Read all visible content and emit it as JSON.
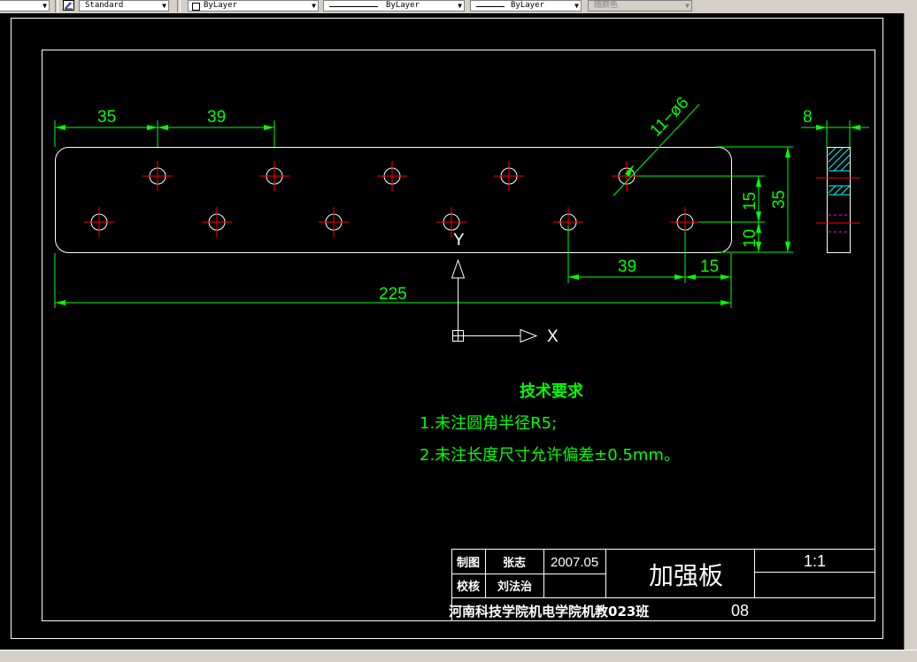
{
  "toolbar": {
    "textstyle_value": "Standard",
    "layer_color_value": "ByLayer",
    "linetype_value": "ByLayer",
    "lineweight_value": "ByLayer",
    "plotstyle_value": "随颜色"
  },
  "drawing": {
    "dims": {
      "d35_top": "35",
      "d39_top": "39",
      "d8": "8",
      "hole_callout": "11−ø6",
      "d15_right": "15",
      "d35_right": "35",
      "d10_right": "10",
      "d39_bottom": "39",
      "d15_bottom": "15",
      "d225": "225"
    },
    "ucs": {
      "x_label": "X",
      "y_label": "Y"
    },
    "notes": {
      "title": "技术要求",
      "line1": "1.未注圆角半径R5;",
      "line2": "2.未注长度尺寸允许偏差±0.5mm。"
    },
    "title_block": {
      "drawn_label": "制图",
      "drawn_name": "张志",
      "date": "2007.05",
      "checked_label": "校核",
      "checked_name": "刘法治",
      "part_name": "加强板",
      "scale": "1:1",
      "school": "河南科技学院机电学院机教023班",
      "drawing_no": "08"
    }
  },
  "colors": {
    "background": "#000000",
    "outline": "#ffffff",
    "dimension": "#00ff00",
    "centerline": "#ff0000",
    "hidden": "#ff00ff",
    "hatch": "#00ffff"
  }
}
